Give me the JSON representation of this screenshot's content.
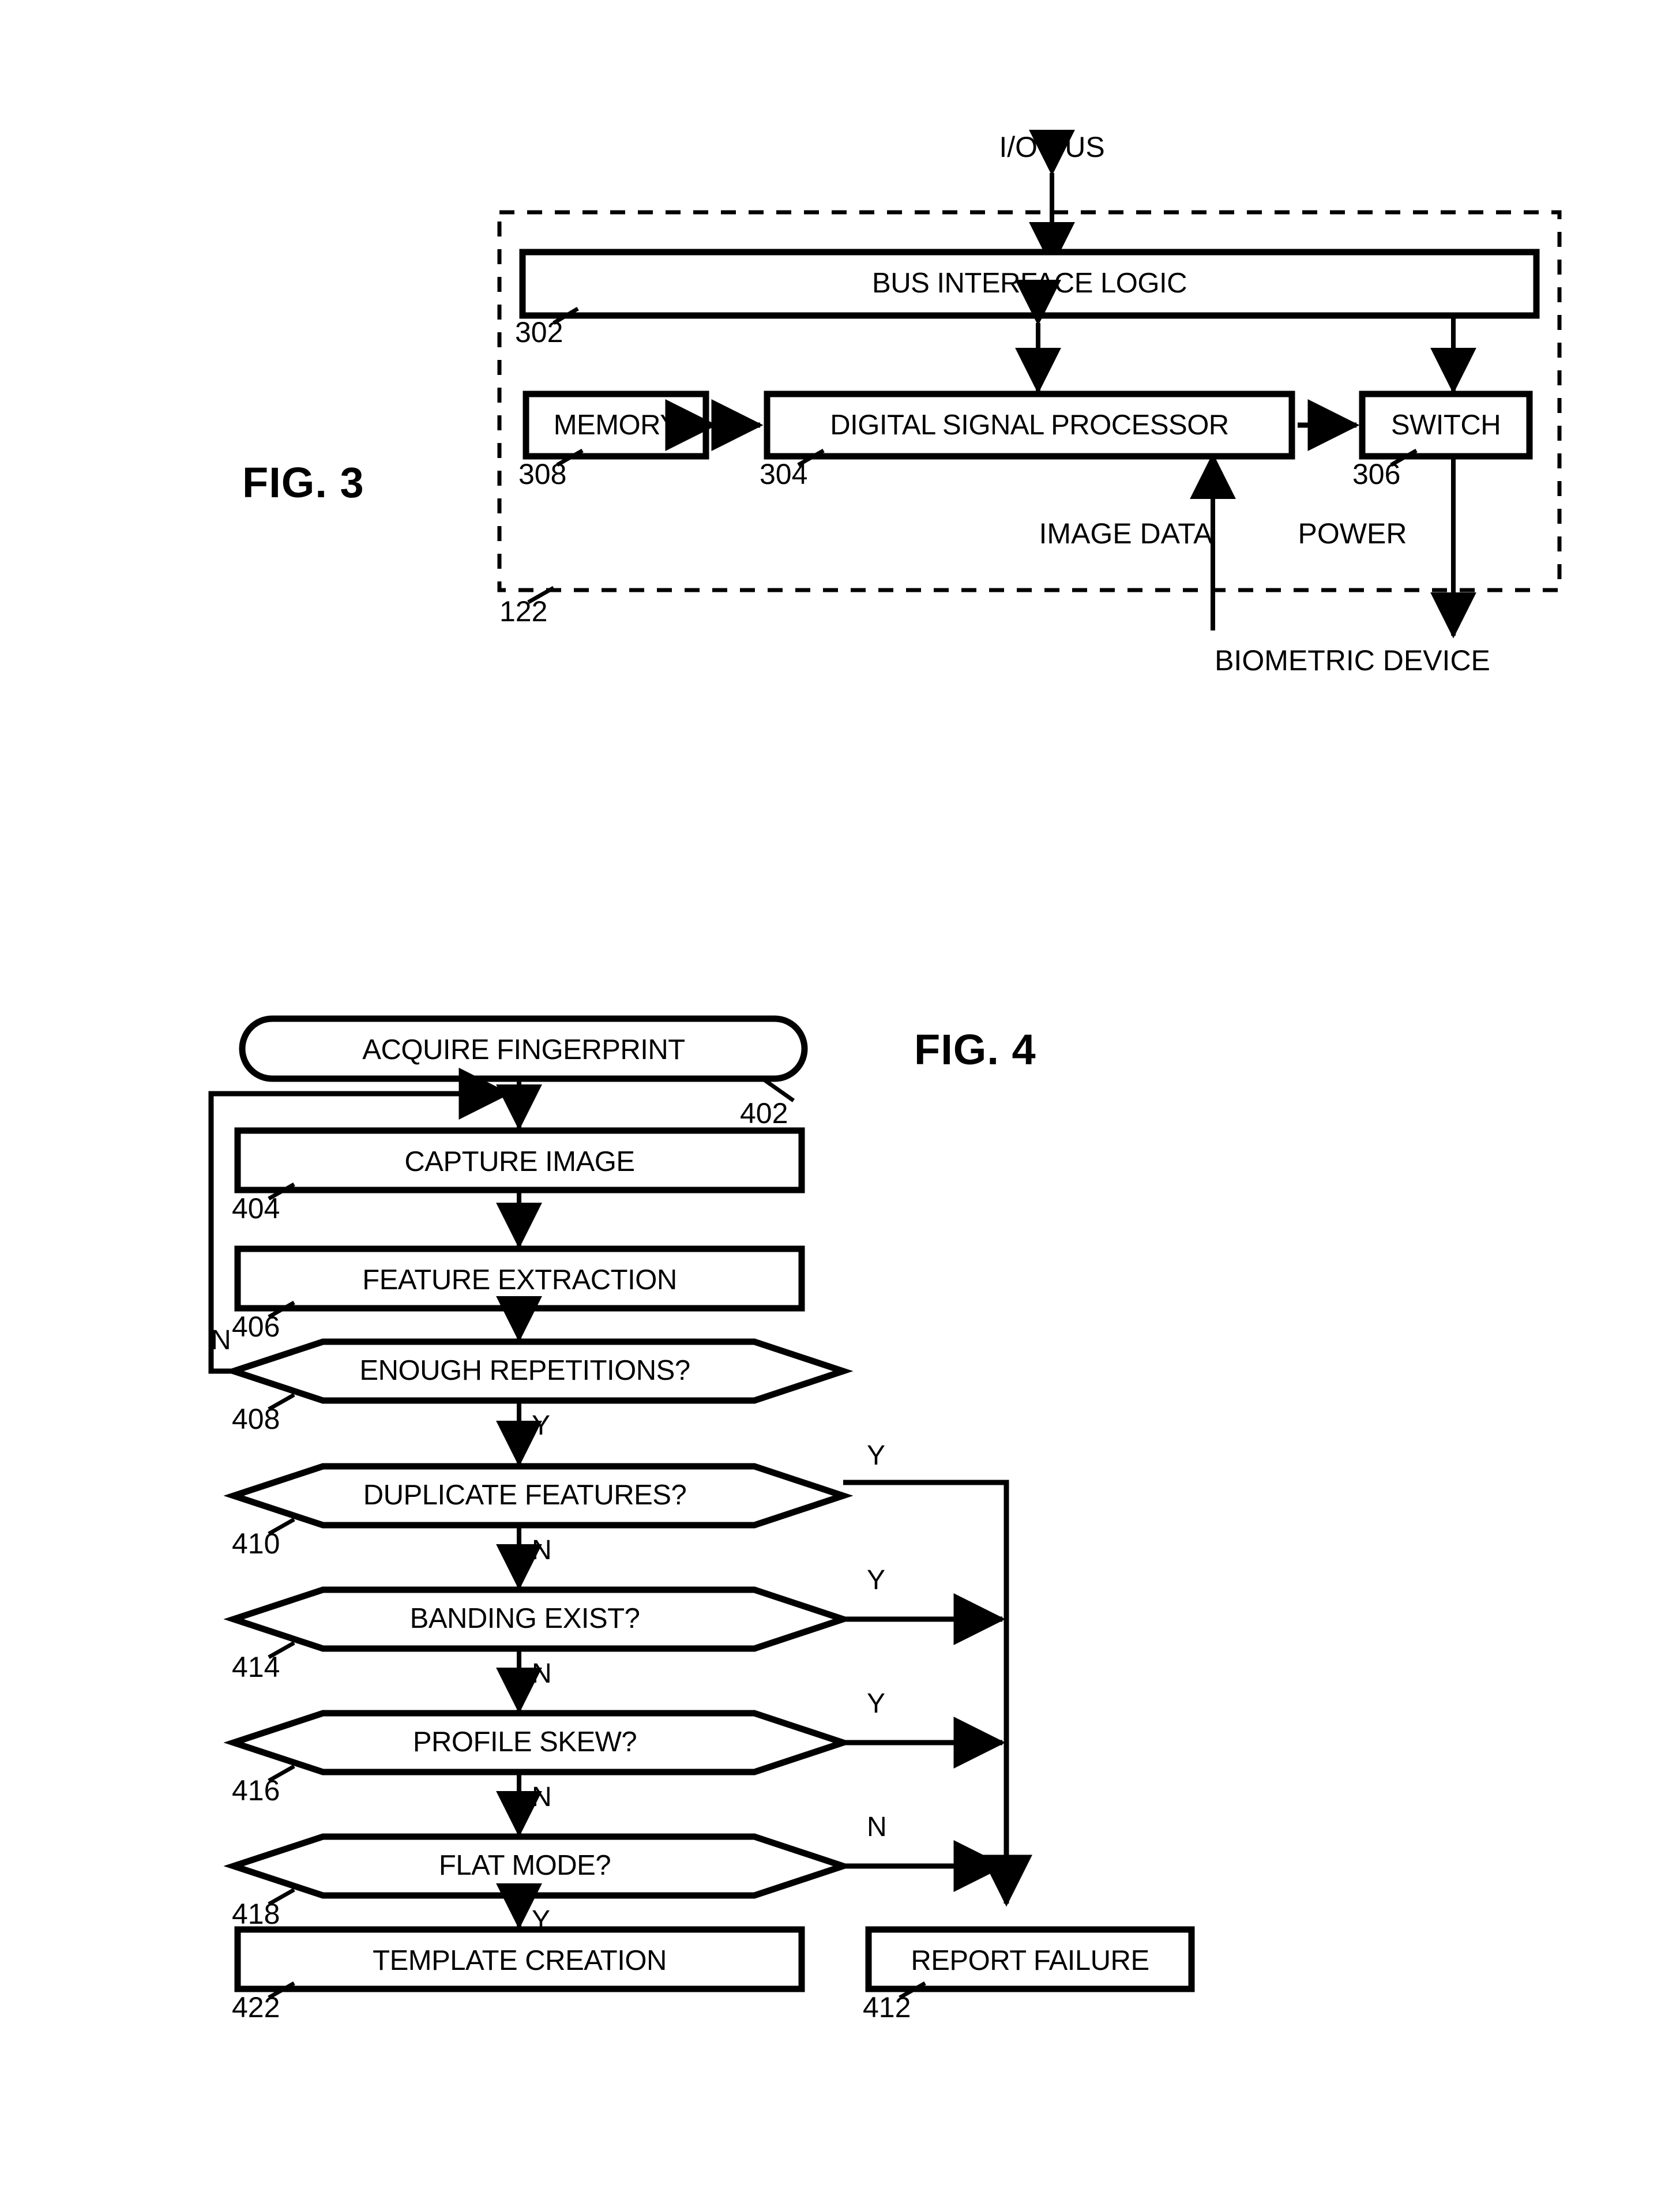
{
  "figures": [
    {
      "id": "fig3",
      "title": "FIG. 3",
      "external_labels": {
        "io_bus": "I/O BUS",
        "biometric_device": "BIOMETRIC DEVICE",
        "image_data": "IMAGE DATA",
        "power": "POWER"
      },
      "enclosure_ref": "122",
      "blocks": [
        {
          "label": "BUS INTERFACE LOGIC",
          "ref": "302"
        },
        {
          "label": "MEMORY",
          "ref": "308"
        },
        {
          "label": "DIGITAL SIGNAL PROCESSOR",
          "ref": "304"
        },
        {
          "label": "SWITCH",
          "ref": "306"
        }
      ]
    },
    {
      "id": "fig4",
      "title": "FIG. 4",
      "nodes": [
        {
          "label": "ACQUIRE FINGERPRINT",
          "ref": "402",
          "shape": "stadium"
        },
        {
          "label": "CAPTURE IMAGE",
          "ref": "404",
          "shape": "rect"
        },
        {
          "label": "FEATURE EXTRACTION",
          "ref": "406",
          "shape": "rect"
        },
        {
          "label": "ENOUGH REPETITIONS?",
          "ref": "408",
          "shape": "hexagon",
          "no_branch": "N",
          "yes_branch": "Y"
        },
        {
          "label": "DUPLICATE FEATURES?",
          "ref": "410",
          "shape": "hexagon",
          "no_branch": "N",
          "yes_branch": "Y"
        },
        {
          "label": "BANDING EXIST?",
          "ref": "414",
          "shape": "hexagon",
          "no_branch": "N",
          "yes_branch": "Y"
        },
        {
          "label": "PROFILE SKEW?",
          "ref": "416",
          "shape": "hexagon",
          "no_branch": "N",
          "yes_branch": "Y"
        },
        {
          "label": "FLAT MODE?",
          "ref": "418",
          "shape": "hexagon",
          "no_branch": "N",
          "yes_branch": "Y"
        },
        {
          "label": "TEMPLATE CREATION",
          "ref": "422",
          "shape": "rect"
        },
        {
          "label": "REPORT FAILURE",
          "ref": "412",
          "shape": "rect"
        }
      ],
      "branch_marks": {
        "enough_rep_no": "N",
        "enough_rep_yes": "Y",
        "dup_yes": "Y",
        "dup_no": "N",
        "banding_yes": "Y",
        "banding_no": "N",
        "skew_yes": "Y",
        "skew_no": "N",
        "flat_no": "N",
        "flat_yes": "Y"
      }
    }
  ],
  "colors": {
    "ink": "#000000",
    "paper": "#ffffff"
  }
}
